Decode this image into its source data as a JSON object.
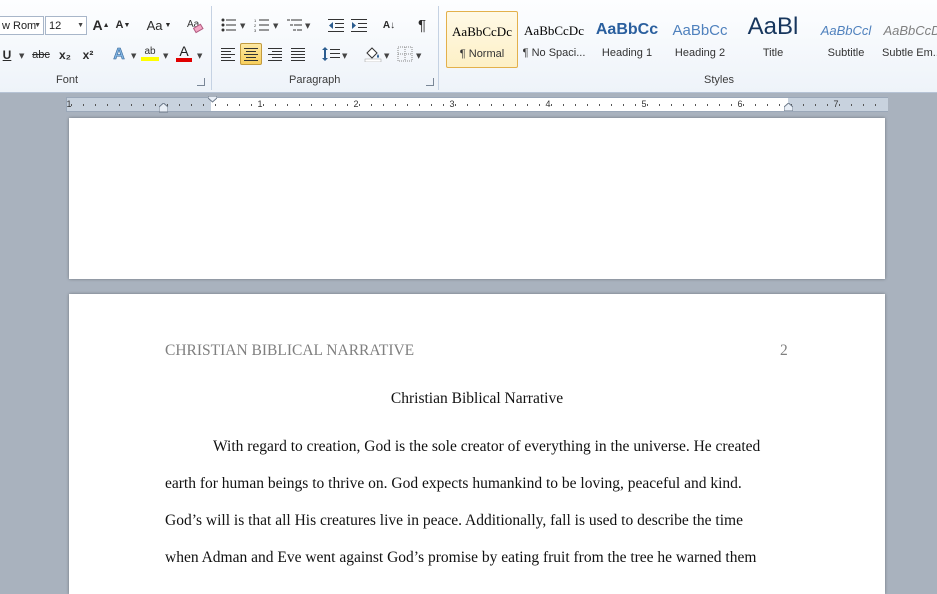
{
  "ribbon": {
    "font_group": {
      "label": "Font",
      "font_name": "w Rom",
      "font_size": "12",
      "grow_label": "A",
      "shrink_label": "A",
      "case_label": "Aa",
      "underline_label": "U",
      "strike_label": "abc",
      "subscript_label": "x₂",
      "superscript_label": "x²",
      "effects_label": "A",
      "highlight_label": "ab",
      "fontcolor_label": "A",
      "highlight_color": "#ffff00",
      "fontcolor_color": "#e00000"
    },
    "paragraph_group": {
      "label": "Paragraph",
      "pilcrow": "¶",
      "sort_label": "A↓"
    },
    "styles_group": {
      "label": "Styles",
      "items": [
        {
          "sample": "AaBbCcDc",
          "name": "¶ Normal",
          "selected": true
        },
        {
          "sample": "AaBbCcDc",
          "name": "¶ No Spaci..."
        },
        {
          "sample": "AaBbCc",
          "name": "Heading 1"
        },
        {
          "sample": "AaBbCc",
          "name": "Heading 2"
        },
        {
          "sample": "AaBl",
          "name": "Title"
        },
        {
          "sample": "AaBbCcl",
          "name": "Subtitle"
        },
        {
          "sample": "AaBbCcD",
          "name": "Subtle Em..."
        }
      ]
    }
  },
  "ruler": {
    "numbers": [
      "1",
      "1",
      "2",
      "3",
      "4",
      "5",
      "6",
      "7"
    ]
  },
  "document": {
    "header_title": "CHRISTIAN BIBLICAL NARRATIVE",
    "page_number": "2",
    "title": "Christian Biblical Narrative",
    "lines": [
      "With regard to creation, God is the sole creator of everything in the universe. He created",
      "earth for human beings to thrive on. God expects humankind to be loving, peaceful and kind.",
      "God’s will is that all His creatures live in peace.  Additionally, fall is used to describe the time",
      "when Adman and Eve went against God’s promise by eating fruit from the tree he warned them"
    ]
  }
}
